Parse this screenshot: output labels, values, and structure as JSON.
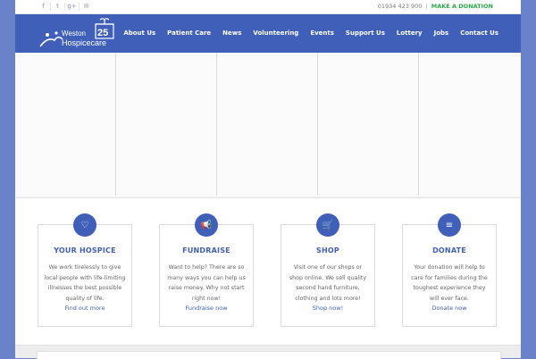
{
  "topbar": {
    "social": [
      {
        "icon": "facebook-icon",
        "glyph": "f"
      },
      {
        "icon": "twitter-icon",
        "glyph": "t"
      },
      {
        "icon": "google-plus-icon",
        "glyph": "g+"
      },
      {
        "icon": "mail-icon",
        "glyph": "✉"
      }
    ],
    "phone": "01934 423 900",
    "separator": "|",
    "donate_label": "MAKE A DONATION"
  },
  "header": {
    "logo_line1": "Weston",
    "logo_line2": "Hospicecare",
    "logo_badge": "25",
    "nav": [
      "About Us",
      "Patient Care",
      "News",
      "Volunteering",
      "Events",
      "Support Us",
      "Lottery",
      "Jobs",
      "Contact Us"
    ]
  },
  "features": [
    {
      "icon": "heart-icon",
      "glyph": "♡",
      "title": "YOUR HOSPICE",
      "text": "We work tirelessly to give local people with life-limiting illnesses the best possible quality of life.",
      "link": "Find out more"
    },
    {
      "icon": "megaphone-icon",
      "glyph": "📢",
      "title": "FUNDRAISE",
      "text": "Want to help? There are so many ways you can help us raise money. Why not start right now!",
      "link": "Fundraise now"
    },
    {
      "icon": "cart-icon",
      "glyph": "🛒",
      "title": "SHOP",
      "text": "Visit one of our shops or shop online. We sell quality second hand furniture, clothing and lots more!",
      "link": "Shop now!"
    },
    {
      "icon": "coins-icon",
      "glyph": "≡",
      "title": "DONATE",
      "text": "Your donation will help to care for families during the toughest experience they will ever face.",
      "link": "Donate now"
    }
  ],
  "colors": {
    "brand": "#3f5fb8",
    "background": "#6a82c9",
    "donate": "#2aa84a"
  }
}
